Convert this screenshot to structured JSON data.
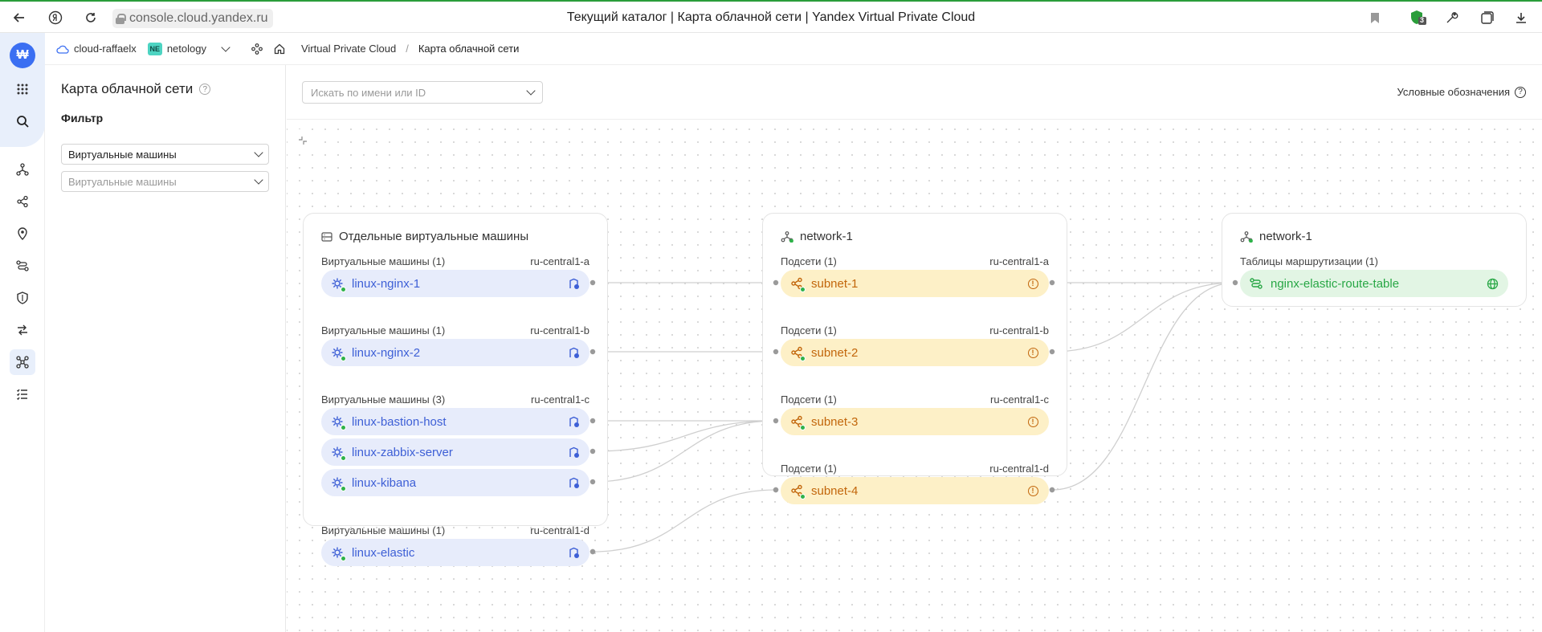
{
  "browser": {
    "url": "console.cloud.yandex.ru",
    "title": "Текущий каталог | Карта облачной сети | Yandex Virtual Private Cloud",
    "extension_badge": "3"
  },
  "rail": {
    "logo_glyph": "₩",
    "items": [
      "all-services",
      "search",
      "vpc-networks",
      "subnets",
      "ip-addresses",
      "routing",
      "security-groups",
      "gateways",
      "network-map",
      "operations"
    ]
  },
  "header": {
    "cloud": "cloud-raffaelx",
    "folder_badge": "NE",
    "folder": "netology",
    "breadcrumb": [
      "Virtual Private Cloud",
      "Карта облачной сети"
    ],
    "separator": "/"
  },
  "filter": {
    "title": "Карта облачной сети",
    "help": "?",
    "subtitle": "Фильтр",
    "resource_type": "Виртуальные машины",
    "resource_placeholder": "Виртуальные машины"
  },
  "canvas": {
    "search_placeholder": "Искать по имени или ID",
    "legend_label": "Условные обозначения",
    "groups": {
      "vms": {
        "title": "Отдельные виртуальные машины",
        "sections": [
          {
            "label": "Виртуальные машины (1)",
            "zone": "ru-central1-a",
            "nodes": [
              "linux-nginx-1"
            ]
          },
          {
            "label": "Виртуальные машины (1)",
            "zone": "ru-central1-b",
            "nodes": [
              "linux-nginx-2"
            ]
          },
          {
            "label": "Виртуальные машины (3)",
            "zone": "ru-central1-c",
            "nodes": [
              "linux-bastion-host",
              "linux-zabbix-server",
              "linux-kibana"
            ]
          },
          {
            "label": "Виртуальные машины (1)",
            "zone": "ru-central1-d",
            "nodes": [
              "linux-elastic"
            ]
          }
        ]
      },
      "network": {
        "title": "network-1",
        "sections": [
          {
            "label": "Подсети (1)",
            "zone": "ru-central1-a",
            "nodes": [
              "subnet-1"
            ]
          },
          {
            "label": "Подсети (1)",
            "zone": "ru-central1-b",
            "nodes": [
              "subnet-2"
            ]
          },
          {
            "label": "Подсети (1)",
            "zone": "ru-central1-c",
            "nodes": [
              "subnet-3"
            ]
          },
          {
            "label": "Подсети (1)",
            "zone": "ru-central1-d",
            "nodes": [
              "subnet-4"
            ]
          }
        ]
      },
      "routes": {
        "title": "network-1",
        "sections": [
          {
            "label": "Таблицы маршрутизации (1)",
            "nodes": [
              "nginx-elastic-route-table"
            ]
          }
        ]
      }
    },
    "links": [
      [
        "linux-nginx-1",
        "subnet-1"
      ],
      [
        "linux-nginx-2",
        "subnet-2"
      ],
      [
        "linux-bastion-host",
        "subnet-3"
      ],
      [
        "linux-zabbix-server",
        "subnet-3"
      ],
      [
        "linux-kibana",
        "subnet-3"
      ],
      [
        "linux-elastic",
        "subnet-4"
      ],
      [
        "subnet-1",
        "nginx-elastic-route-table"
      ],
      [
        "subnet-2",
        "nginx-elastic-route-table"
      ],
      [
        "subnet-4",
        "nginx-elastic-route-table"
      ]
    ],
    "colors": {
      "vm": "#3d5fd6",
      "vm_bg": "#e7ecfb",
      "subnet": "#c2660b",
      "subnet_bg": "#fdf0c7",
      "route": "#28a745",
      "route_bg": "#e2f5e4",
      "status_running": "#2fb24a"
    }
  }
}
